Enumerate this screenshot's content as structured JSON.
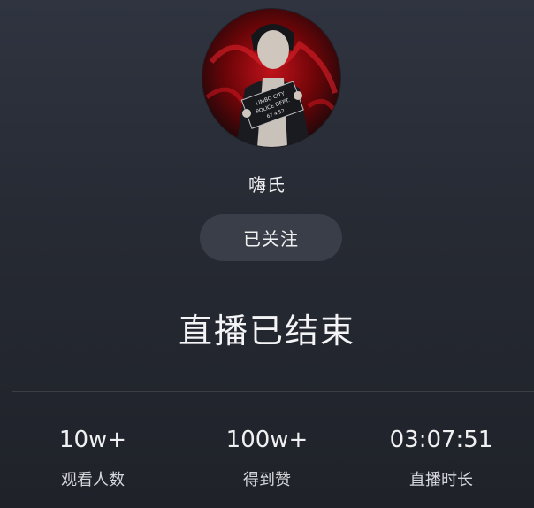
{
  "streamer": {
    "name": "嗨氏",
    "avatar_sign_lines": [
      "LIMBO CITY",
      "POLICE DEPT.",
      "67 4 52"
    ]
  },
  "follow_button": {
    "label": "已关注"
  },
  "status": {
    "title": "直播已结束"
  },
  "stats": [
    {
      "value": "10w+",
      "label": "观看人数"
    },
    {
      "value": "100w+",
      "label": "得到赞"
    },
    {
      "value": "03:07:51",
      "label": "直播时长"
    }
  ],
  "colors": {
    "background_top": "#2f3440",
    "background_bottom": "#1f2229",
    "button_bg": "#3a3e48",
    "text": "#f0f0f2",
    "avatar_red": "#8f0b10"
  }
}
